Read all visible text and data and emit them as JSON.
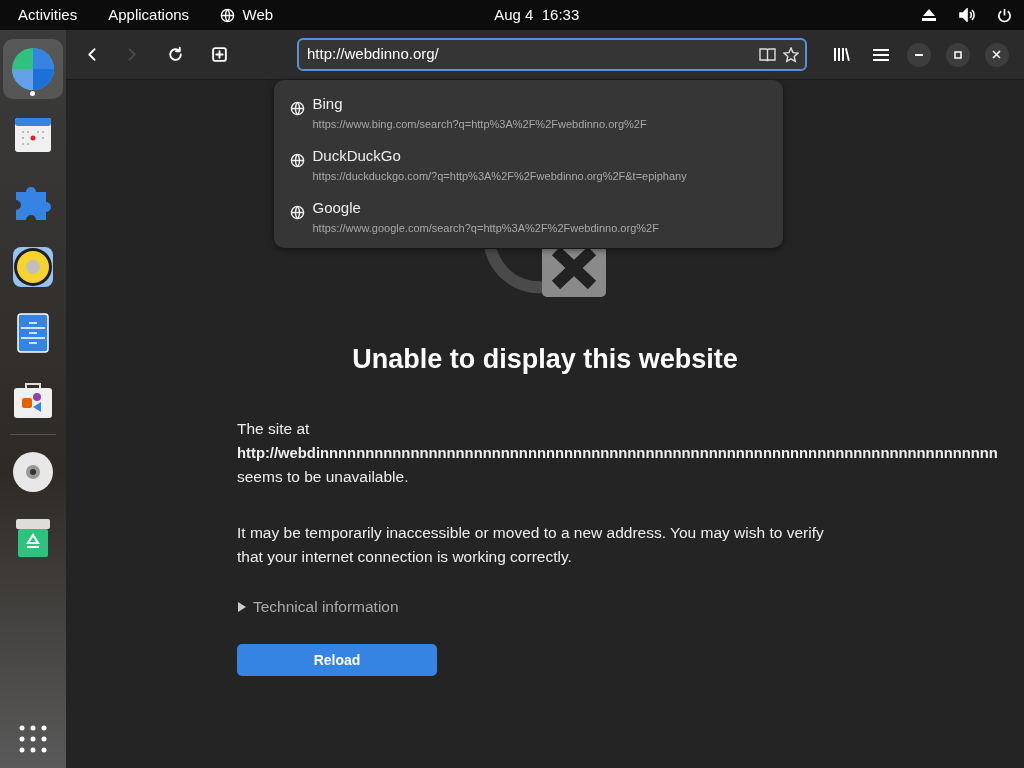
{
  "top_bar": {
    "activities": "Activities",
    "applications": "Applications",
    "app_menu": "Web",
    "clock": "Aug 4  16:33"
  },
  "dock": {
    "items": [
      {
        "kind": "web",
        "running": true
      },
      {
        "kind": "calendar",
        "running": false
      },
      {
        "kind": "extensions",
        "running": false
      },
      {
        "kind": "rhythmbox",
        "running": false
      },
      {
        "kind": "files",
        "running": false
      },
      {
        "kind": "software",
        "running": false
      },
      {
        "kind": "disc",
        "running": false
      },
      {
        "kind": "trash",
        "running": false
      }
    ]
  },
  "toolbar": {
    "nav_buttons": [
      {
        "kind": "back",
        "disabled": false
      },
      {
        "kind": "forward",
        "disabled": true
      },
      {
        "kind": "reload",
        "disabled": false
      },
      {
        "kind": "new_tab",
        "disabled": false
      }
    ],
    "address": "http://webdinno.org/"
  },
  "suggestions": [
    {
      "title": "Bing",
      "url": "https://www.bing.com/search?q=http%3A%2F%2Fwebdinno.org%2F"
    },
    {
      "title": "DuckDuckGo",
      "url": "https://duckduckgo.com/?q=http%3A%2F%2Fwebdinno.org%2F&t=epiphany"
    },
    {
      "title": "Google",
      "url": "https://www.google.com/search?q=http%3A%2F%2Fwebdinno.org%2F"
    }
  ],
  "error": {
    "title": "Unable to display this website",
    "paragraphs": [
      "The site at **http://webdinnnnnnnnnnnnnnnnnnnnnnnnnnnnnnnnnnnnnnnnnnnnnnnnnnnnnnnnnnnnnnnnnnnnnnnnnnn** seems to be unavailable.",
      "It may be temporarily inaccessible or moved to a new address. You may wish to verify that your internet connection is working correctly."
    ],
    "details": {
      "label": "Technical information",
      "expanded": false
    },
    "button": "Reload"
  }
}
